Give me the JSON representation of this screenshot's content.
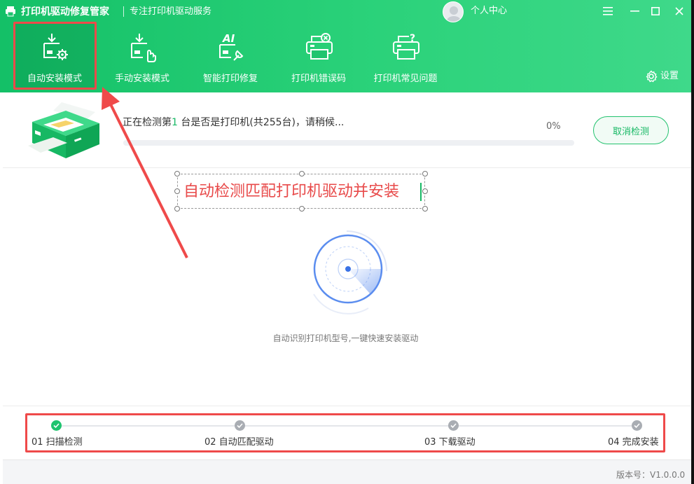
{
  "app": {
    "title": "打印机驱动修复管家",
    "subtitle": "专注打印机驱动服务",
    "user_center": "个人中心",
    "settings_label": "设置"
  },
  "nav": [
    {
      "label": "自动安装模式",
      "icon": "auto-install-icon",
      "active": true
    },
    {
      "label": "手动安装模式",
      "icon": "manual-install-icon",
      "active": false
    },
    {
      "label": "智能打印修复",
      "icon": "ai-repair-icon",
      "active": false
    },
    {
      "label": "打印机错误码",
      "icon": "printer-error-icon",
      "active": false
    },
    {
      "label": "打印机常见问题",
      "icon": "printer-faq-icon",
      "active": false
    }
  ],
  "detect": {
    "prefix": "正在检测第",
    "current": "1",
    "suffix": " 台是否是打印机(共255台)，请稍候...",
    "percent_label": "0%",
    "progress": 0,
    "cancel_label": "取消检测"
  },
  "annotation": {
    "text": "自动检测匹配打印机驱动并安装"
  },
  "radar_caption": "自动识别打印机型号,一键快速安装驱动",
  "steps": [
    {
      "label": "01 扫描检测",
      "done": true
    },
    {
      "label": "02 自动匹配驱动",
      "done": false
    },
    {
      "label": "03 下载驱动",
      "done": false
    },
    {
      "label": "04 完成安装",
      "done": false
    }
  ],
  "version": "版本号：V1.0.0.0",
  "colors": {
    "brand_green": "#1fc46f",
    "highlight_red": "#ef4a4a",
    "annotation_red": "#e84a4a"
  }
}
